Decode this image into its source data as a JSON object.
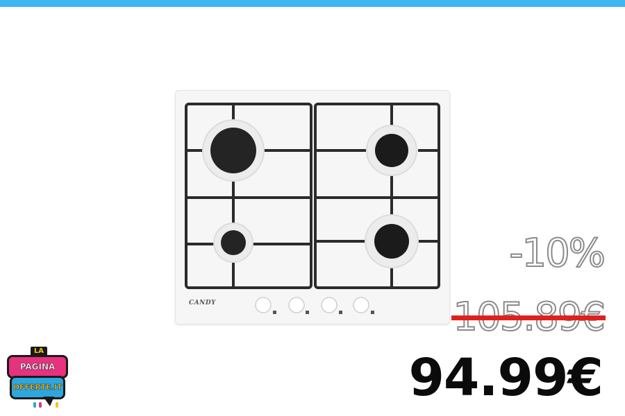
{
  "product": {
    "name": "",
    "brand": "CANDY"
  },
  "pricing": {
    "discount": "-10%",
    "old_price": "105.89€",
    "new_price": "94.99€"
  },
  "logo": {
    "top": "LA",
    "line1": "PAGINA DELLE",
    "line2": "OFFERTE.IT"
  },
  "colors": {
    "top_bar": "#3fb6f2",
    "strike": "#e0201d",
    "price": "#0b0b0b",
    "logo_pink": "#e8317f",
    "logo_blue": "#2ea6e0",
    "logo_yellow": "#f6c21a"
  }
}
